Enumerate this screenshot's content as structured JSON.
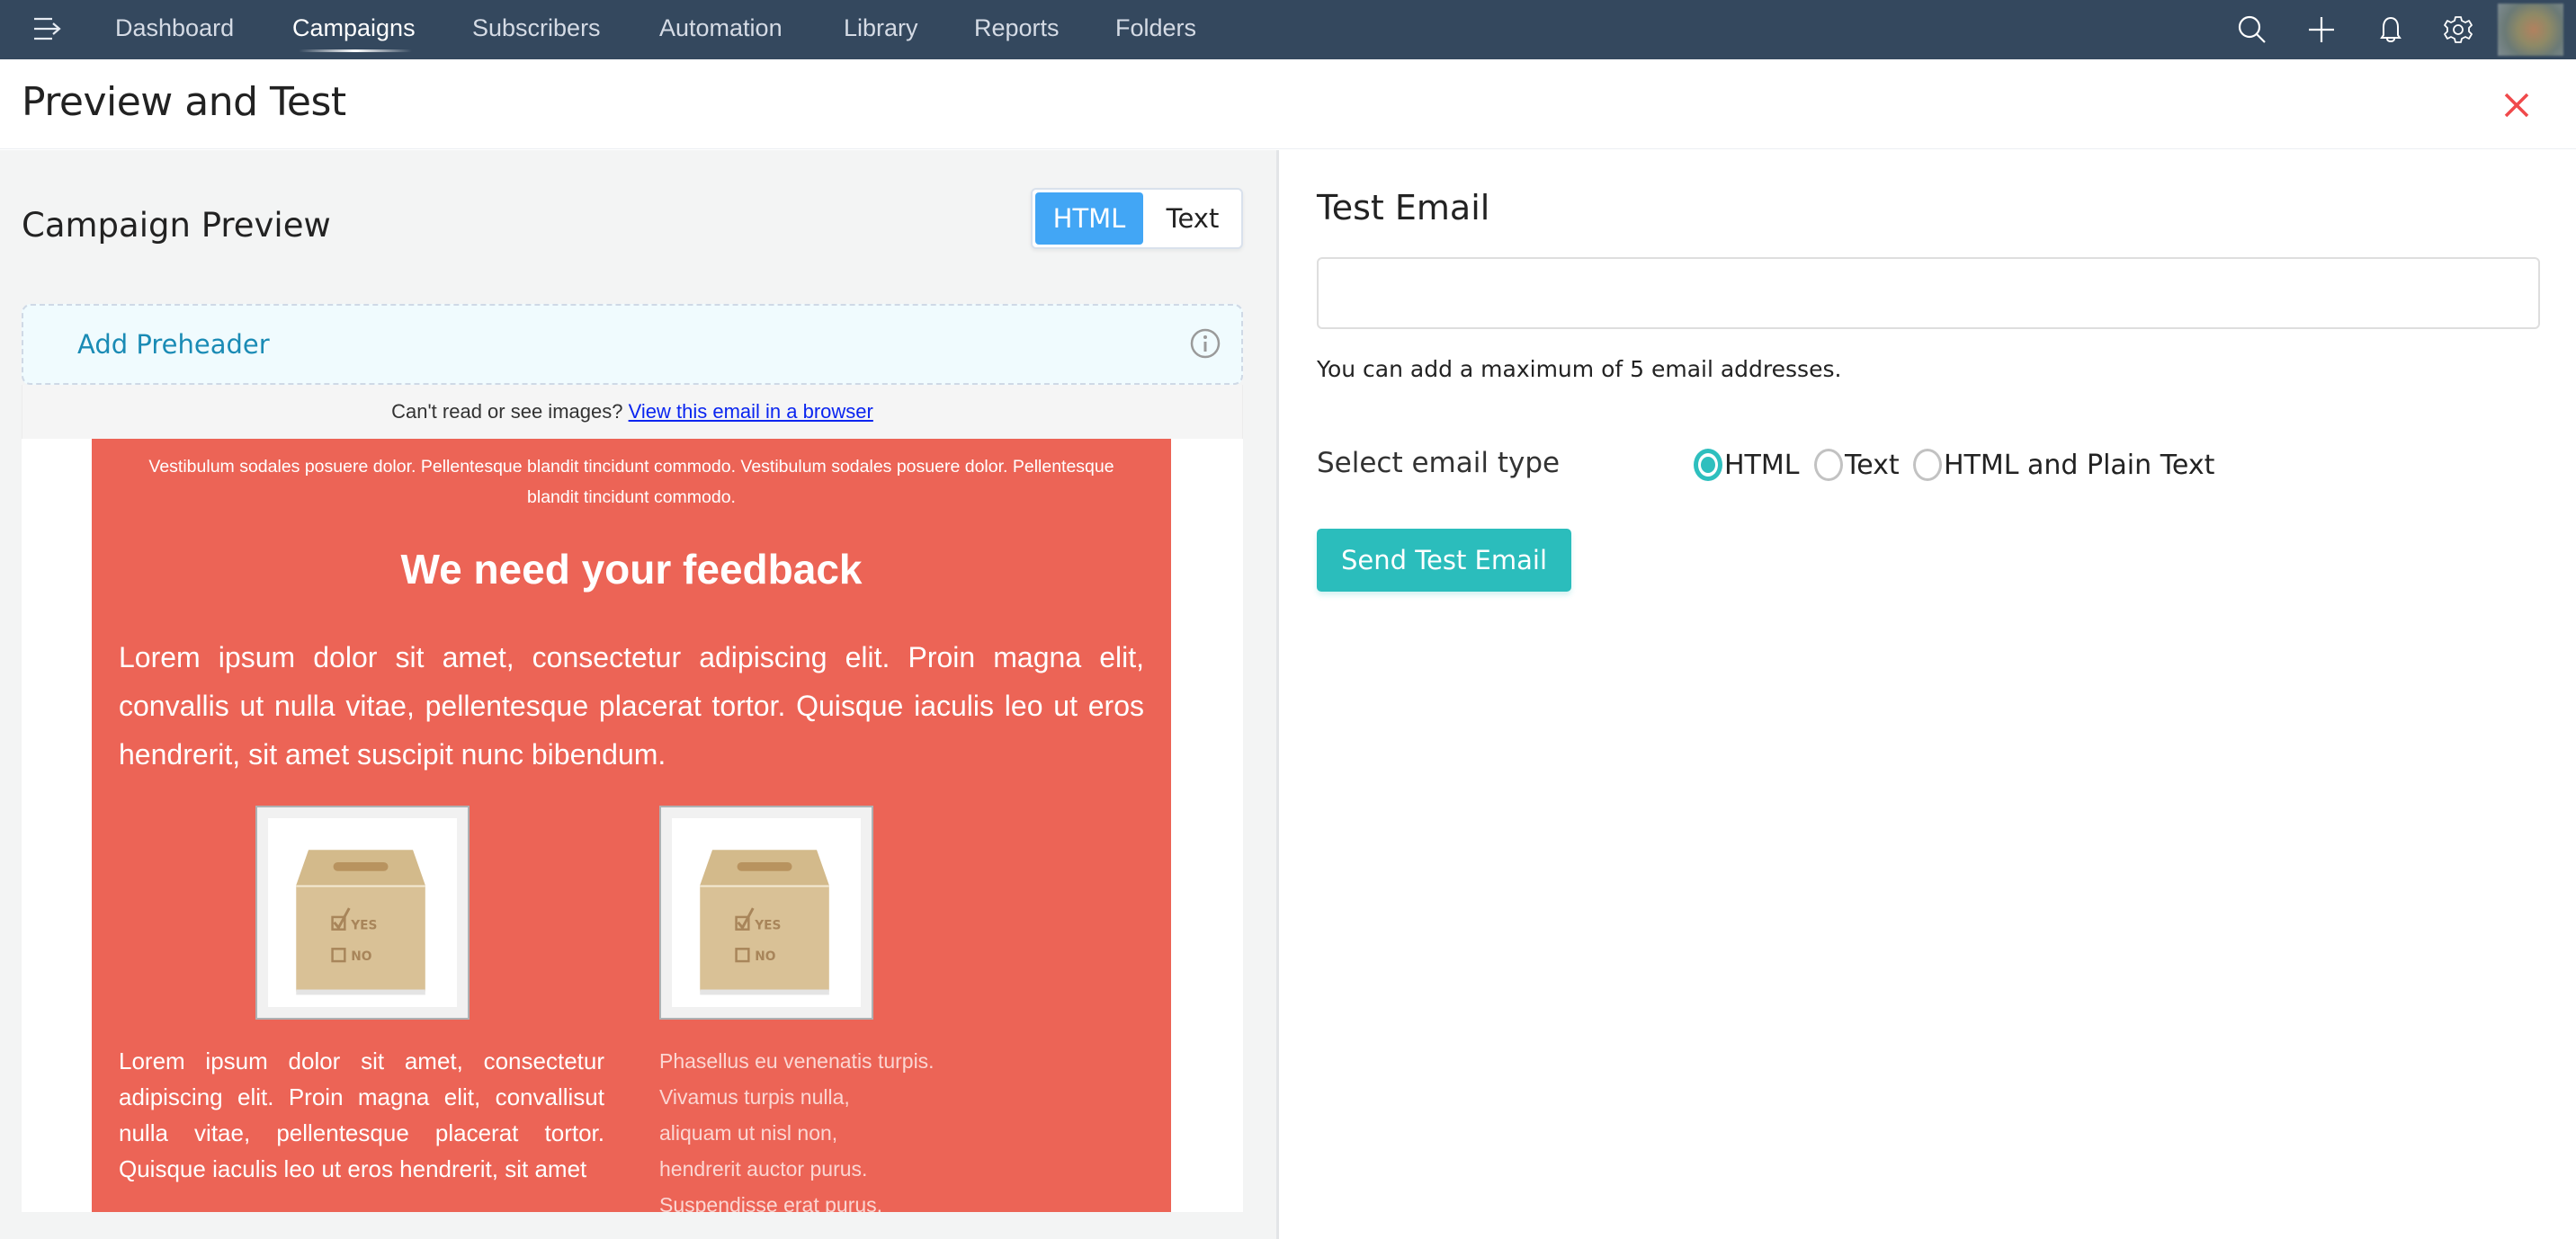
{
  "nav": {
    "items": [
      {
        "label": "Dashboard",
        "active": false
      },
      {
        "label": "Campaigns",
        "active": true
      },
      {
        "label": "Subscribers",
        "active": false
      },
      {
        "label": "Automation",
        "active": false
      },
      {
        "label": "Library",
        "active": false
      },
      {
        "label": "Reports",
        "active": false
      },
      {
        "label": "Folders",
        "active": false
      }
    ],
    "icons": [
      "menu-icon",
      "search-icon",
      "plus-icon",
      "bell-icon",
      "gear-icon"
    ]
  },
  "header": {
    "title": "Preview and Test"
  },
  "preview": {
    "title": "Campaign Preview",
    "toggle": {
      "html_label": "HTML",
      "text_label": "Text",
      "selected": "HTML"
    },
    "preheader_label": "Add Preheader",
    "cant_read_text": "Can't read or see images?",
    "view_in_browser_link": " View this email in a browser",
    "email": {
      "top_text": "Vestibulum sodales posuere dolor. Pellentesque blandit tincidunt commodo. Vestibulum sodales posuere dolor. Pellentesque blandit tincidunt commodo.",
      "heading": "We need your feedback",
      "body": "Lorem ipsum dolor sit amet, consectetur adipiscing elit. Proin magna elit, convallis ut nulla vitae, pellentesque placerat tortor. Quisque iaculis leo ut eros hendrerit, sit amet suscipit nunc bibendum.",
      "image_box_labels": {
        "yes": "YES",
        "no": "NO"
      },
      "left_column": "Lorem ipsum dolor sit amet, consectetur adipiscing elit. Proin magna elit, convallisut nulla vitae, pellentesque placerat tortor. Quisque iaculis leo ut eros hendrerit, sit amet",
      "right_column": [
        "Phasellus eu venenatis turpis.",
        "Vivamus turpis nulla,",
        "aliquam ut nisl non,",
        "hendrerit auctor purus.",
        "Suspendisse erat purus."
      ],
      "background_color": "#ec6456"
    }
  },
  "test_email": {
    "title": "Test Email",
    "input_value": "",
    "input_placeholder": "",
    "help_text": "You can add a maximum of 5 email addresses.",
    "select_label": "Select email type",
    "options": [
      {
        "label": "HTML",
        "checked": true
      },
      {
        "label": "Text",
        "checked": false
      },
      {
        "label": "HTML and Plain Text",
        "checked": false
      }
    ],
    "send_button": "Send Test Email"
  },
  "colors": {
    "nav_bg": "#34485e",
    "accent_blue": "#42a6f5",
    "accent_teal": "#2bbdbc",
    "close_red": "#f0494b",
    "link_blue": "#1a8bb5"
  }
}
